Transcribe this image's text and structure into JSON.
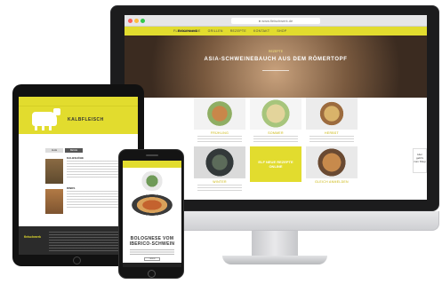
{
  "desktop": {
    "url": "● www.fleischwerk.de",
    "logo": "fleischwerk",
    "nav_items": [
      "FLEISCHKUNDE",
      "GRILLEN",
      "REZEPTE",
      "KONTAKT",
      "SHOP"
    ],
    "hero": {
      "kicker": "REZEPTE",
      "title": "ASIA-SCHWEINEBAUCH AUS DEM RÖMERTOPF"
    },
    "cards": [
      {
        "label": "FRÜHLING"
      },
      {
        "label": "SOMMER"
      },
      {
        "label": "HERBST"
      },
      {
        "label": "WINTER"
      },
      {
        "label": "ELF NEUE REZEPTE ONLINE"
      },
      {
        "label": "GLEICH ANMELDEN"
      }
    ],
    "side_badge": "Hier geht's zum Shop",
    "colors": {
      "brand_yellow": "#e2dc2e"
    }
  },
  "tablet": {
    "page_title": "KALBFLEISCH",
    "tabs": [
      "ALLE",
      "KEULE"
    ],
    "items": [
      {
        "name": "KALBSHÖHE"
      },
      {
        "name": "RINDS"
      }
    ],
    "footer_logo": "fleischwerk"
  },
  "phone": {
    "title": "BOLOGNESE VOM IBERICO-SCHWEIN",
    "button": "LESEN"
  }
}
